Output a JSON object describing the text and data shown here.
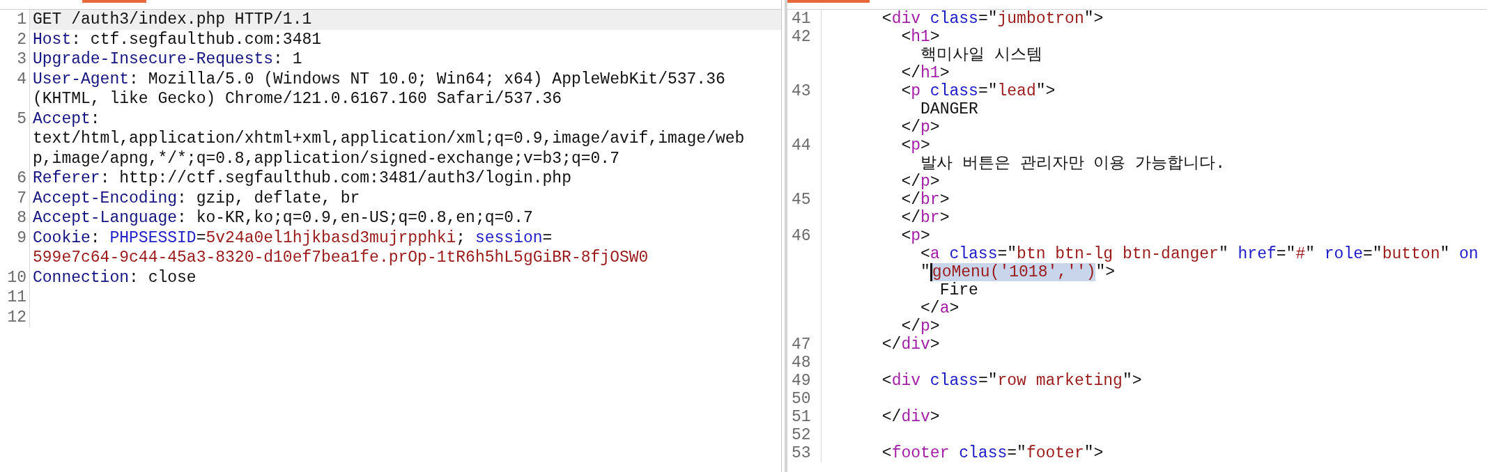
{
  "request_editor": {
    "lines": [
      {
        "number": "1",
        "current": true,
        "rows": [
          {
            "segments": [
              {
                "kind": "text",
                "text": "GET /auth3/index.php HTTP/1.1"
              }
            ]
          }
        ]
      },
      {
        "number": "2",
        "current": false,
        "rows": [
          {
            "segments": [
              {
                "kind": "name",
                "text": "Host"
              },
              {
                "kind": "text",
                "text": ": ctf.segfaulthub.com:3481"
              }
            ]
          }
        ]
      },
      {
        "number": "3",
        "current": false,
        "rows": [
          {
            "segments": [
              {
                "kind": "name",
                "text": "Upgrade-Insecure-Requests"
              },
              {
                "kind": "text",
                "text": ": 1"
              }
            ]
          }
        ]
      },
      {
        "number": "4",
        "current": false,
        "rows": [
          {
            "segments": [
              {
                "kind": "name",
                "text": "User-Agent"
              },
              {
                "kind": "text",
                "text": ": Mozilla/5.0 (Windows NT 10.0; Win64; x64) AppleWebKit/537.36"
              }
            ]
          },
          {
            "segments": [
              {
                "kind": "text",
                "text": "(KHTML, like Gecko) Chrome/121.0.6167.160 Safari/537.36"
              }
            ]
          }
        ]
      },
      {
        "number": "5",
        "current": false,
        "rows": [
          {
            "segments": [
              {
                "kind": "name",
                "text": "Accept"
              },
              {
                "kind": "text",
                "text": ":"
              }
            ]
          },
          {
            "segments": [
              {
                "kind": "text",
                "text": "text/html,application/xhtml+xml,application/xml;q=0.9,image/avif,image/web"
              }
            ]
          },
          {
            "segments": [
              {
                "kind": "text",
                "text": "p,image/apng,*/*;q=0.8,application/signed-exchange;v=b3;q=0.7"
              }
            ]
          }
        ]
      },
      {
        "number": "6",
        "current": false,
        "rows": [
          {
            "segments": [
              {
                "kind": "name",
                "text": "Referer"
              },
              {
                "kind": "text",
                "text": ": http://ctf.segfaulthub.com:3481/auth3/login.php"
              }
            ]
          }
        ]
      },
      {
        "number": "7",
        "current": false,
        "rows": [
          {
            "segments": [
              {
                "kind": "name",
                "text": "Accept-Encoding"
              },
              {
                "kind": "text",
                "text": ": gzip, deflate, br"
              }
            ]
          }
        ]
      },
      {
        "number": "8",
        "current": false,
        "rows": [
          {
            "segments": [
              {
                "kind": "name",
                "text": "Accept-Language"
              },
              {
                "kind": "text",
                "text": ": ko-KR,ko;q=0.9,en-US;q=0.8,en;q=0.7"
              }
            ]
          }
        ]
      },
      {
        "number": "9",
        "current": false,
        "rows": [
          {
            "segments": [
              {
                "kind": "name",
                "text": "Cookie"
              },
              {
                "kind": "text",
                "text": ": "
              },
              {
                "kind": "param",
                "text": "PHPSESSID"
              },
              {
                "kind": "text",
                "text": "="
              },
              {
                "kind": "value",
                "text": "5v24a0el1hjkbasd3mujrpphki"
              },
              {
                "kind": "text",
                "text": "; "
              },
              {
                "kind": "param",
                "text": "session"
              },
              {
                "kind": "text",
                "text": "="
              }
            ]
          },
          {
            "segments": [
              {
                "kind": "value",
                "text": "599e7c64-9c44-45a3-8320-d10ef7bea1fe.prOp-1tR6h5hL5gGiBR-8fjOSW0"
              }
            ]
          }
        ]
      },
      {
        "number": "10",
        "current": false,
        "rows": [
          {
            "segments": [
              {
                "kind": "name",
                "text": "Connection"
              },
              {
                "kind": "text",
                "text": ": close"
              }
            ]
          }
        ]
      },
      {
        "number": "11",
        "current": false
      },
      {
        "number": "12",
        "current": false
      }
    ]
  },
  "response_editor": {
    "lines": [
      {
        "number": "41",
        "rows": [
          {
            "segments": [
              {
                "kind": "text",
                "text": "      <"
              },
              {
                "kind": "tag",
                "text": "div"
              },
              {
                "kind": "attr",
                "text": " class"
              },
              {
                "kind": "text",
                "text": "=\""
              },
              {
                "kind": "string",
                "text": "jumbotron"
              },
              {
                "kind": "text",
                "text": "\">"
              }
            ]
          }
        ]
      },
      {
        "number": "42",
        "rows": [
          {
            "segments": [
              {
                "kind": "text",
                "text": "        <"
              },
              {
                "kind": "tag",
                "text": "h1"
              },
              {
                "kind": "text",
                "text": ">"
              }
            ]
          },
          {
            "segments": [
              {
                "kind": "text",
                "text": "          핵미사일 시스템"
              }
            ]
          },
          {
            "segments": [
              {
                "kind": "text",
                "text": "        </"
              },
              {
                "kind": "tag",
                "text": "h1"
              },
              {
                "kind": "text",
                "text": ">"
              }
            ]
          }
        ]
      },
      {
        "number": "43",
        "rows": [
          {
            "segments": [
              {
                "kind": "text",
                "text": "        <"
              },
              {
                "kind": "tag",
                "text": "p"
              },
              {
                "kind": "attr",
                "text": " class"
              },
              {
                "kind": "text",
                "text": "=\""
              },
              {
                "kind": "string",
                "text": "lead"
              },
              {
                "kind": "text",
                "text": "\">"
              }
            ]
          },
          {
            "segments": [
              {
                "kind": "text",
                "text": "          DANGER"
              }
            ]
          },
          {
            "segments": [
              {
                "kind": "text",
                "text": "        </"
              },
              {
                "kind": "tag",
                "text": "p"
              },
              {
                "kind": "text",
                "text": ">"
              }
            ]
          }
        ]
      },
      {
        "number": "44",
        "rows": [
          {
            "segments": [
              {
                "kind": "text",
                "text": "        <"
              },
              {
                "kind": "tag",
                "text": "p"
              },
              {
                "kind": "text",
                "text": ">"
              }
            ]
          },
          {
            "segments": [
              {
                "kind": "text",
                "text": "          발사 버튼은 관리자만 이용 가능합니다."
              }
            ]
          },
          {
            "segments": [
              {
                "kind": "text",
                "text": "        </"
              },
              {
                "kind": "tag",
                "text": "p"
              },
              {
                "kind": "text",
                "text": ">"
              }
            ]
          }
        ]
      },
      {
        "number": "45",
        "rows": [
          {
            "segments": [
              {
                "kind": "text",
                "text": "        </"
              },
              {
                "kind": "tag",
                "text": "br"
              },
              {
                "kind": "text",
                "text": ">"
              }
            ]
          },
          {
            "segments": [
              {
                "kind": "text",
                "text": "        </"
              },
              {
                "kind": "tag",
                "text": "br"
              },
              {
                "kind": "text",
                "text": ">"
              }
            ]
          }
        ]
      },
      {
        "number": "46",
        "rows": [
          {
            "segments": [
              {
                "kind": "text",
                "text": "        <"
              },
              {
                "kind": "tag",
                "text": "p"
              },
              {
                "kind": "text",
                "text": ">"
              }
            ]
          },
          {
            "segments": [
              {
                "kind": "text",
                "text": "          <"
              },
              {
                "kind": "tag",
                "text": "a"
              },
              {
                "kind": "attr",
                "text": " class"
              },
              {
                "kind": "text",
                "text": "=\""
              },
              {
                "kind": "string",
                "text": "btn btn-lg btn-danger"
              },
              {
                "kind": "text",
                "text": "\" "
              },
              {
                "kind": "attr",
                "text": "href"
              },
              {
                "kind": "text",
                "text": "=\""
              },
              {
                "kind": "string",
                "text": "#"
              },
              {
                "kind": "text",
                "text": "\" "
              },
              {
                "kind": "attr",
                "text": "role"
              },
              {
                "kind": "text",
                "text": "=\""
              },
              {
                "kind": "string",
                "text": "button"
              },
              {
                "kind": "text",
                "text": "\" "
              },
              {
                "kind": "attr",
                "text": "on"
              }
            ]
          },
          {
            "segments": [
              {
                "kind": "text",
                "text": "          \""
              },
              {
                "kind": "string",
                "text": "goMenu('1018','')",
                "highlighted": true,
                "cursor": true
              },
              {
                "kind": "text",
                "text": "\">"
              }
            ]
          },
          {
            "segments": [
              {
                "kind": "text",
                "text": "            Fire"
              }
            ]
          },
          {
            "segments": [
              {
                "kind": "text",
                "text": "          </"
              },
              {
                "kind": "tag",
                "text": "a"
              },
              {
                "kind": "text",
                "text": ">"
              }
            ]
          },
          {
            "segments": [
              {
                "kind": "text",
                "text": "        </"
              },
              {
                "kind": "tag",
                "text": "p"
              },
              {
                "kind": "text",
                "text": ">"
              }
            ]
          }
        ]
      },
      {
        "number": "47",
        "rows": [
          {
            "segments": [
              {
                "kind": "text",
                "text": "      </"
              },
              {
                "kind": "tag",
                "text": "div"
              },
              {
                "kind": "text",
                "text": ">"
              }
            ]
          }
        ]
      },
      {
        "number": "48"
      },
      {
        "number": "49",
        "rows": [
          {
            "segments": [
              {
                "kind": "text",
                "text": "      <"
              },
              {
                "kind": "tag",
                "text": "div"
              },
              {
                "kind": "attr",
                "text": " class"
              },
              {
                "kind": "text",
                "text": "=\""
              },
              {
                "kind": "string",
                "text": "row marketing"
              },
              {
                "kind": "text",
                "text": "\">"
              }
            ]
          }
        ]
      },
      {
        "number": "50"
      },
      {
        "number": "51",
        "rows": [
          {
            "segments": [
              {
                "kind": "text",
                "text": "      </"
              },
              {
                "kind": "tag",
                "text": "div"
              },
              {
                "kind": "text",
                "text": ">"
              }
            ]
          }
        ]
      },
      {
        "number": "52"
      },
      {
        "number": "53",
        "rows": [
          {
            "segments": [
              {
                "kind": "text",
                "text": "      <"
              },
              {
                "kind": "tag",
                "text": "footer"
              },
              {
                "kind": "attr",
                "text": " class"
              },
              {
                "kind": "text",
                "text": "=\""
              },
              {
                "kind": "string",
                "text": "footer"
              },
              {
                "kind": "text",
                "text": "\">"
              }
            ]
          }
        ]
      }
    ]
  }
}
